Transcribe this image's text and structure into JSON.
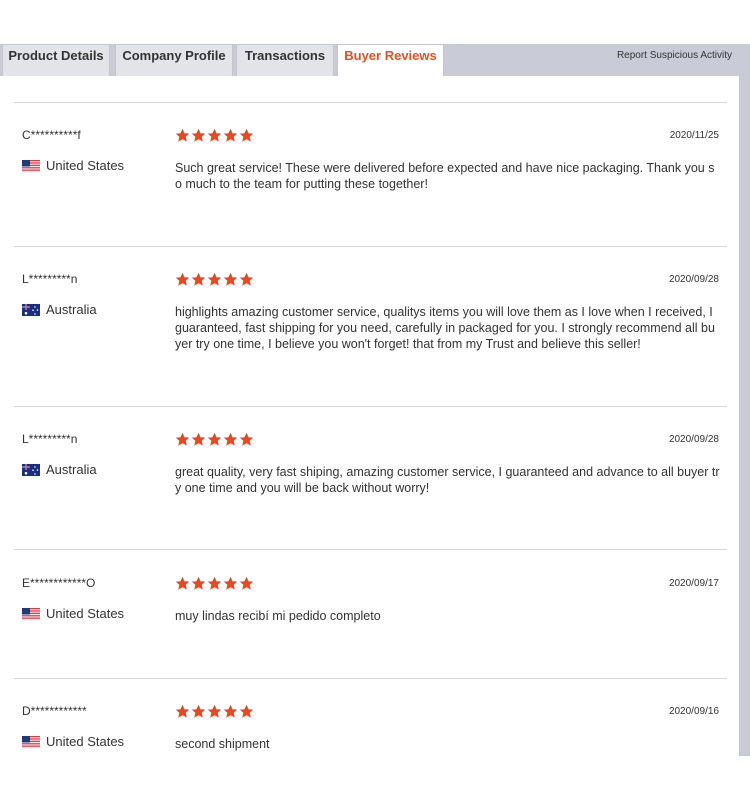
{
  "tabs": [
    {
      "label": "Product Details",
      "active": false
    },
    {
      "label": "Company Profile",
      "active": false
    },
    {
      "label": "Transactions",
      "active": false
    },
    {
      "label": "Buyer Reviews",
      "active": true
    }
  ],
  "report_link": "Report Suspicious Activity",
  "colors": {
    "accent": "#e8501f",
    "star": "#f0471a"
  },
  "reviews": [
    {
      "buyer": "C**********f",
      "country": "United States",
      "flag": "us-flag-icon",
      "rating": 5,
      "date": "2020/11/25",
      "text": "Such great service! These were delivered before expected and have nice packaging. Thank you so much to the team for putting these together!"
    },
    {
      "buyer": "L*********n",
      "country": "Australia",
      "flag": "au-flag-icon",
      "rating": 5,
      "date": "2020/09/28",
      "text": "highlights amazing customer service, qualitys items you will love them as I love when I received, I guaranteed, fast shipping for you need, carefully in packaged for you. I strongly recommend all buyer try one time, I believe you won't forget! that from my Trust and believe this seller!"
    },
    {
      "buyer": "L*********n",
      "country": "Australia",
      "flag": "au-flag-icon",
      "rating": 5,
      "date": "2020/09/28",
      "text": "great quality, very fast shiping, amazing customer service, I guaranteed and advance to all buyer try one time and you will be back without worry!"
    },
    {
      "buyer": "E************O",
      "country": "United States",
      "flag": "us-flag-icon",
      "rating": 5,
      "date": "2020/09/17",
      "text": "muy lindas recibí mi pedido completo"
    },
    {
      "buyer": "D************",
      "country": "United States",
      "flag": "us-flag-icon",
      "rating": 5,
      "date": "2020/09/16",
      "text": "second shipment"
    }
  ]
}
